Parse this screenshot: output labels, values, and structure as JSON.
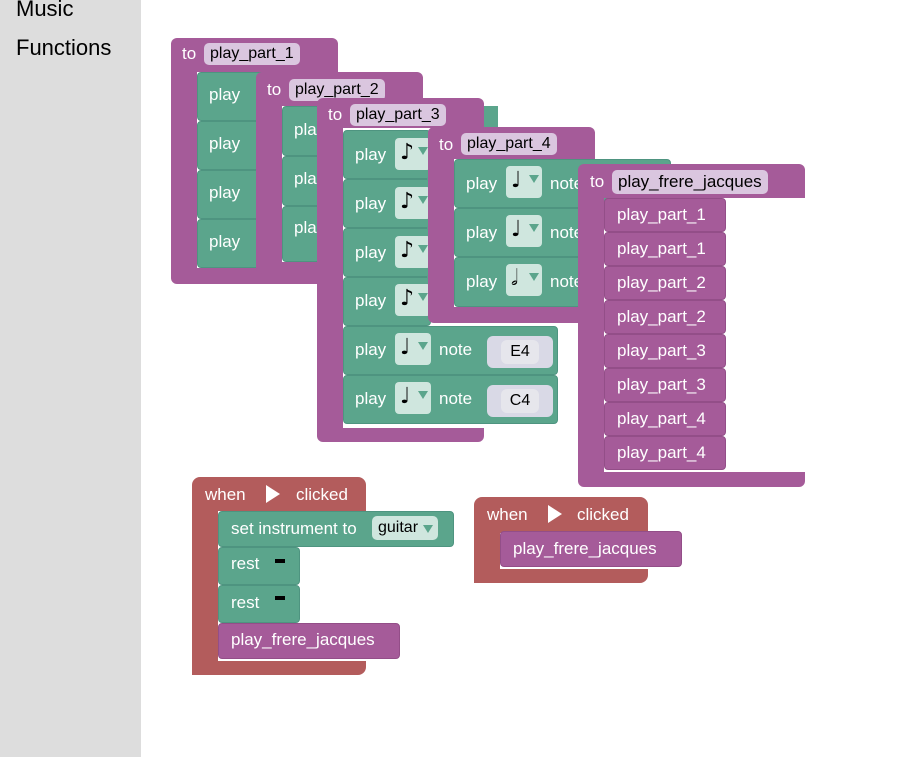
{
  "sidebar": {
    "categories": [
      "Music",
      "Functions"
    ]
  },
  "blocks": {
    "to_label": "to",
    "play_label": "play",
    "note_label": "note",
    "procedures": {
      "p1": "play_part_1",
      "p2": "play_part_2",
      "p3": "play_part_3",
      "p4": "play_part_4",
      "main": "play_frere_jacques"
    },
    "part3_notes": [
      "E4",
      "C4"
    ],
    "main_calls": [
      "play_part_1",
      "play_part_1",
      "play_part_2",
      "play_part_2",
      "play_part_3",
      "play_part_3",
      "play_part_4",
      "play_part_4"
    ],
    "when_label": "when",
    "clicked_label": "clicked",
    "set_instrument_label": "set instrument to",
    "instrument_value": "guitar",
    "rest_label": "rest",
    "call_main": "play_frere_jacques"
  },
  "colors": {
    "procedure": "#a55b99",
    "music": "#5ba58c",
    "event": "#b35c5c",
    "sidebar": "#dddddd"
  }
}
